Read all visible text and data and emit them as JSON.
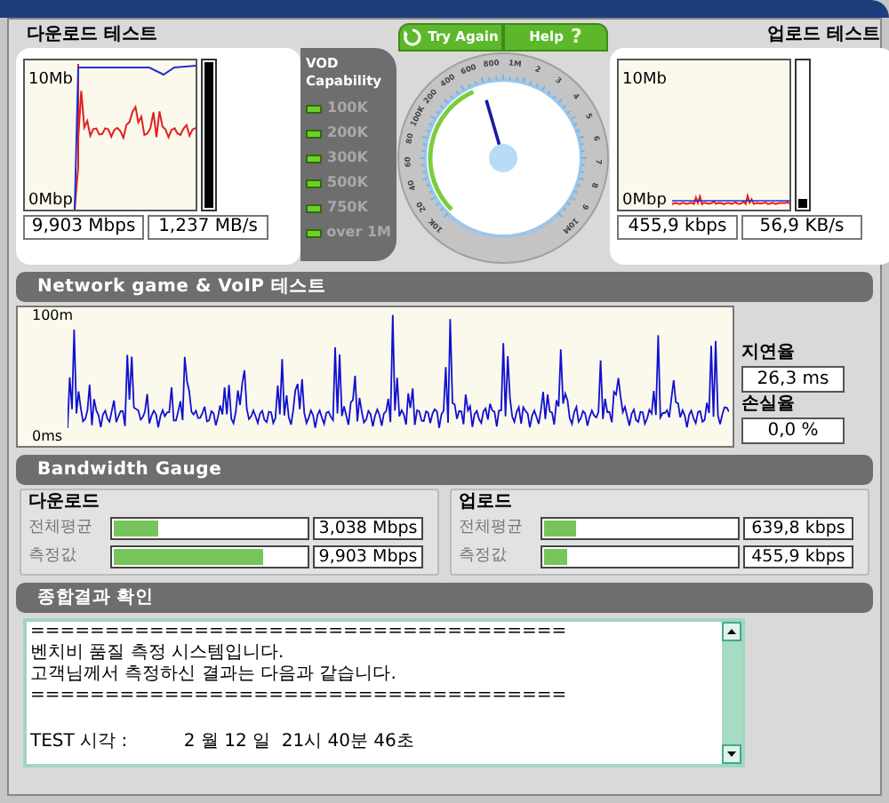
{
  "download": {
    "title": "다운로드 테스트",
    "axis_top": "10Mb",
    "axis_bottom": "0Mbp",
    "meter": {
      "level": 1
    },
    "readings": [
      "9,903 Mbps",
      "1,237 MB/s"
    ]
  },
  "vod": {
    "title": "VOD Capability",
    "items": [
      {
        "label": "100K",
        "on": true
      },
      {
        "label": "200K",
        "on": true
      },
      {
        "label": "300K",
        "on": true
      },
      {
        "label": "500K",
        "on": true
      },
      {
        "label": "750K",
        "on": true
      },
      {
        "label": "over 1M",
        "on": true
      }
    ]
  },
  "gauge": {
    "buttons": [
      {
        "label": "Try Again",
        "kind": "retry"
      },
      {
        "label": "Help",
        "kind": "help",
        "glyph": "?"
      }
    ],
    "scale": [
      "10K",
      "20",
      "40",
      "60",
      "80",
      "100K",
      "200",
      "400",
      "600",
      "800",
      "1M",
      "2",
      "3",
      "4",
      "5",
      "6",
      "7",
      "8",
      "9",
      "10M"
    ]
  },
  "upload": {
    "title": "업로드 테스트",
    "axis_top": "10Mb",
    "axis_bottom": "0Mbp",
    "meter": {
      "level": 0.06
    },
    "readings": [
      "455,9 kbps",
      "56,9 KB/s"
    ]
  },
  "network": {
    "title": "Network game & VoIP 테스트",
    "axis_top": "100m",
    "axis_bottom": "0ms",
    "stats": [
      {
        "label": "지연율",
        "value": "26,3 ms"
      },
      {
        "label": "손실율",
        "value": "0,0 %"
      }
    ]
  },
  "bandwidth": {
    "title": "Bandwidth Gauge",
    "groups": [
      {
        "title": "다운로드",
        "rows": [
          {
            "label": "전체평균",
            "level": 0.23,
            "value": "3,038 Mbps"
          },
          {
            "label": "측정값",
            "level": 0.78,
            "value": "9,903 Mbps"
          }
        ]
      },
      {
        "title": "업로드",
        "rows": [
          {
            "label": "전체평균",
            "level": 0.17,
            "value": "639,8 kbps"
          },
          {
            "label": "측정값",
            "level": 0.12,
            "value": "455,9 kbps"
          }
        ]
      }
    ]
  },
  "summary": {
    "title": "종합결과 확인",
    "lines": [
      "====================================",
      "벤치비 품질 측정 시스템입니다.",
      "고객님께서 측정하신 결과는 다음과 같습니다.",
      "====================================",
      "TEST 시각 :          2 월 12 일  21시 40분 46초"
    ]
  }
}
